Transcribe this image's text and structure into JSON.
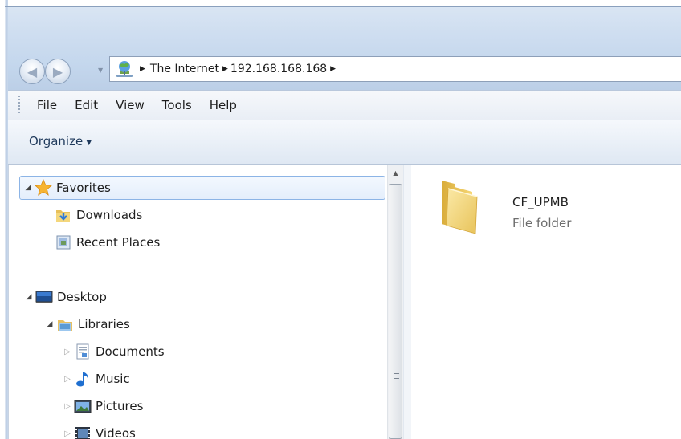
{
  "address": {
    "crumbs": [
      "The Internet",
      "192.168.168.168"
    ]
  },
  "menu": [
    "File",
    "Edit",
    "View",
    "Tools",
    "Help"
  ],
  "toolbar": {
    "organize_label": "Organize"
  },
  "tree": {
    "favorites": "Favorites",
    "downloads": "Downloads",
    "recent_places": "Recent Places",
    "desktop": "Desktop",
    "libraries": "Libraries",
    "documents": "Documents",
    "music": "Music",
    "pictures": "Pictures",
    "videos": "Videos"
  },
  "content": {
    "items": [
      {
        "name": "CF_UPMB",
        "type": "File folder"
      }
    ]
  },
  "icons": {
    "back": "back-arrow-icon",
    "forward": "forward-arrow-icon",
    "network": "network-globe-icon",
    "favorites": "star-icon",
    "downloads": "downloads-folder-icon",
    "recent": "recent-places-icon",
    "desktop": "desktop-icon",
    "libraries": "libraries-icon",
    "documents": "documents-icon",
    "music": "music-note-icon",
    "pictures": "pictures-icon",
    "videos": "videos-icon",
    "folder": "folder-icon"
  },
  "colors": {
    "selection_border": "#8cb4e6",
    "selection_fill": "#e4eefc",
    "link_text": "#1e395b",
    "glass": "#c4d7ed"
  }
}
